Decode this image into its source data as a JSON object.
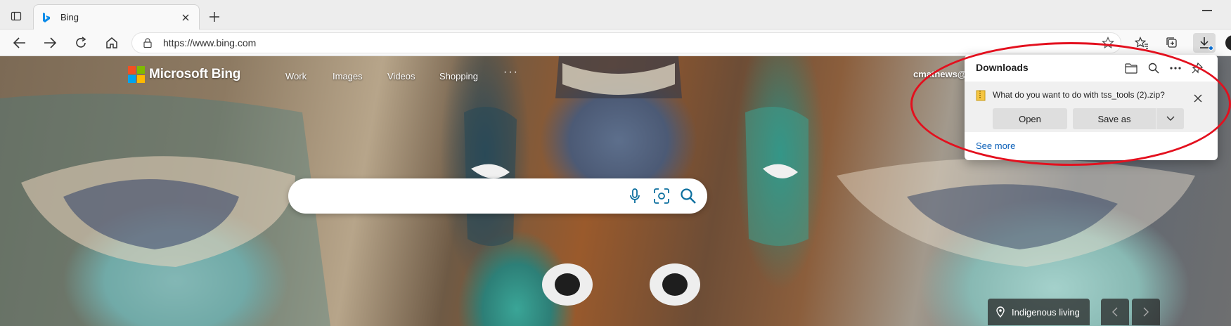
{
  "browser": {
    "tab": {
      "title": "Bing"
    },
    "address": {
      "url": "https://www.bing.com"
    }
  },
  "bing": {
    "brand": "Microsoft Bing",
    "nav": [
      "Work",
      "Images",
      "Videos",
      "Shopping"
    ],
    "nav_more": "···",
    "user": "cmathews@",
    "search": {
      "value": ""
    },
    "image_caption": "Indigenous living"
  },
  "downloads": {
    "title": "Downloads",
    "item": {
      "question": "What do you want to do with tss_tools (2).zip?",
      "open_label": "Open",
      "saveas_label": "Save as"
    },
    "see_more": "See more"
  },
  "colors": {
    "bing_accent": "#0c6f9e",
    "link": "#0a5fb8",
    "annotation": "#e3101e",
    "ms_red": "#f25022",
    "ms_green": "#7fba00",
    "ms_blue": "#00a4ef",
    "ms_yellow": "#ffb900"
  },
  "icons": [
    "sidebar-icon",
    "bing-favicon",
    "close-icon",
    "plus-icon",
    "back-icon",
    "forward-icon",
    "refresh-icon",
    "home-icon",
    "lock-icon",
    "star-icon",
    "favorites-icon",
    "collections-icon",
    "download-icon",
    "folder-icon",
    "search-icon",
    "more-icon",
    "pin-icon",
    "microphone-icon",
    "visual-search-icon",
    "location-icon",
    "chevron-left-icon",
    "chevron-right-icon",
    "chevron-down-icon",
    "zip-file-icon"
  ]
}
